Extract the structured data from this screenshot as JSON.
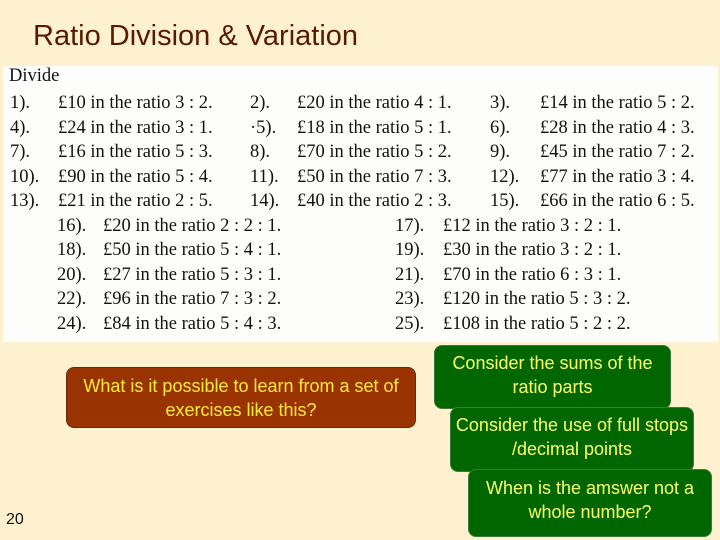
{
  "title": "Ratio Division & Variation",
  "worksheet": {
    "heading": "Divide",
    "items": [
      {
        "n": "1).",
        "t": "£10 in the ratio 3 : 2."
      },
      {
        "n": "2).",
        "t": "£20 in the ratio 4 : 1."
      },
      {
        "n": "3).",
        "t": "£14 in the ratio 5 : 2."
      },
      {
        "n": "4).",
        "t": "£24 in the ratio 3 : 1."
      },
      {
        "n": "·5).",
        "t": "£18 in the ratio 5 : 1."
      },
      {
        "n": "6).",
        "t": "£28 in the ratio 4 : 3."
      },
      {
        "n": "7).",
        "t": "£16 in the ratio 5 : 3."
      },
      {
        "n": "8).",
        "t": "£70 in the ratio 5 : 2."
      },
      {
        "n": "9).",
        "t": "£45 in the ratio 7 : 2."
      },
      {
        "n": "10).",
        "t": "£90 in the ratio 5 : 4."
      },
      {
        "n": "11).",
        "t": "£50 in the ratio 7 : 3."
      },
      {
        "n": "12).",
        "t": "£77 in the ratio 3 : 4."
      },
      {
        "n": "13).",
        "t": "£21 in the ratio 2 : 5."
      },
      {
        "n": "14).",
        "t": "£40 in the ratio 2 : 3."
      },
      {
        "n": "15).",
        "t": "£66 in the ratio 6 : 5."
      },
      {
        "n": "16).",
        "t": "£20 in the ratio 2 : 2 : 1."
      },
      {
        "n": "17).",
        "t": "£12 in the ratio 3 : 2 : 1."
      },
      {
        "n": "18).",
        "t": "£50 in the ratio 5 : 4 : 1."
      },
      {
        "n": "19).",
        "t": "£30 in the ratio 3 : 2 : 1."
      },
      {
        "n": "20).",
        "t": "£27 in the ratio 5 : 3 : 1."
      },
      {
        "n": "21).",
        "t": "£70 in the ratio 6 : 3 : 1."
      },
      {
        "n": "22).",
        "t": "£96 in the ratio 7 : 3 : 2."
      },
      {
        "n": "23).",
        "t": "£120 in the ratio 5 : 3 : 2."
      },
      {
        "n": "24).",
        "t": "£84 in the ratio 5 : 4 : 3."
      },
      {
        "n": "25).",
        "t": "£108 in the ratio 5 : 2 : 2."
      }
    ]
  },
  "callouts": {
    "question": "What is it possible to learn from a set of exercises like this?",
    "hint1": "Consider the sums of the ratio parts",
    "hint2": "Consider the use of full stops /decimal points",
    "hint3": "When is the amswer not a whole number?"
  },
  "colors": {
    "question_bg": "#993300",
    "hint_bg": "#006600",
    "hint_text": "#ffff66"
  },
  "page_number": "20"
}
